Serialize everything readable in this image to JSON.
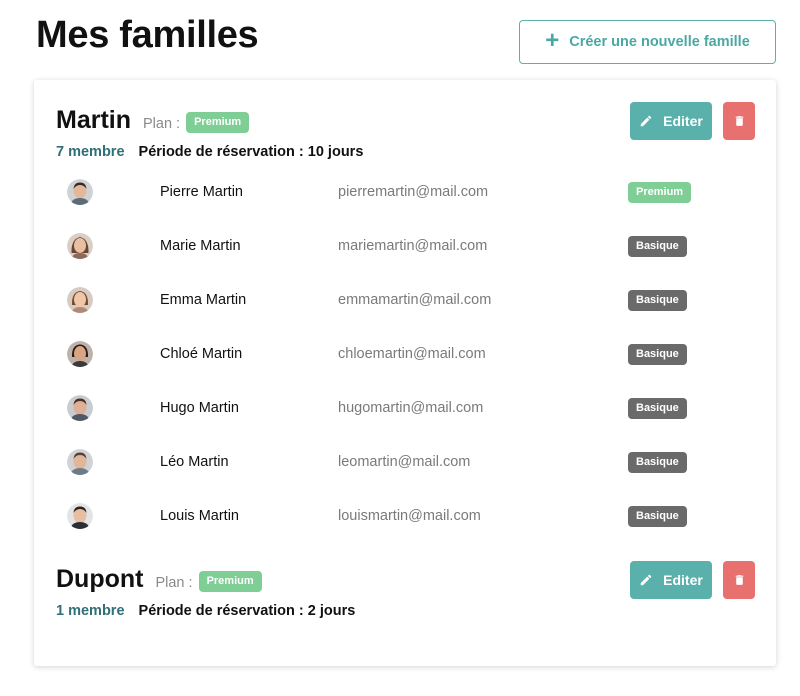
{
  "page": {
    "title": "Mes familles"
  },
  "create_button": {
    "label": "Créer une nouvelle famille",
    "icon": "plus-icon"
  },
  "colors": {
    "accent": "#5ab0ab",
    "danger": "#e8706f",
    "premium": "#7fce95",
    "basic": "#6a6a6a",
    "member_count": "#2f6f77"
  },
  "families": [
    {
      "name": "Martin",
      "plan_label": "Plan :",
      "plan": "Premium",
      "member_count": "7 membre",
      "reservation": "Période de réservation : 10 jours",
      "edit_label": "Editer",
      "members": [
        {
          "name": "Pierre Martin",
          "email": "pierremartin@mail.com",
          "plan": "Premium"
        },
        {
          "name": "Marie Martin",
          "email": "mariemartin@mail.com",
          "plan": "Basique"
        },
        {
          "name": "Emma Martin",
          "email": "emmamartin@mail.com",
          "plan": "Basique"
        },
        {
          "name": "Chloé Martin",
          "email": "chloemartin@mail.com",
          "plan": "Basique"
        },
        {
          "name": "Hugo Martin",
          "email": "hugomartin@mail.com",
          "plan": "Basique"
        },
        {
          "name": "Léo Martin",
          "email": "leomartin@mail.com",
          "plan": "Basique"
        },
        {
          "name": "Louis Martin",
          "email": "louismartin@mail.com",
          "plan": "Basique"
        }
      ]
    },
    {
      "name": "Dupont",
      "plan_label": "Plan :",
      "plan": "Premium",
      "member_count": "1 membre",
      "reservation": "Période de réservation : 2 jours",
      "edit_label": "Editer",
      "members": []
    }
  ]
}
